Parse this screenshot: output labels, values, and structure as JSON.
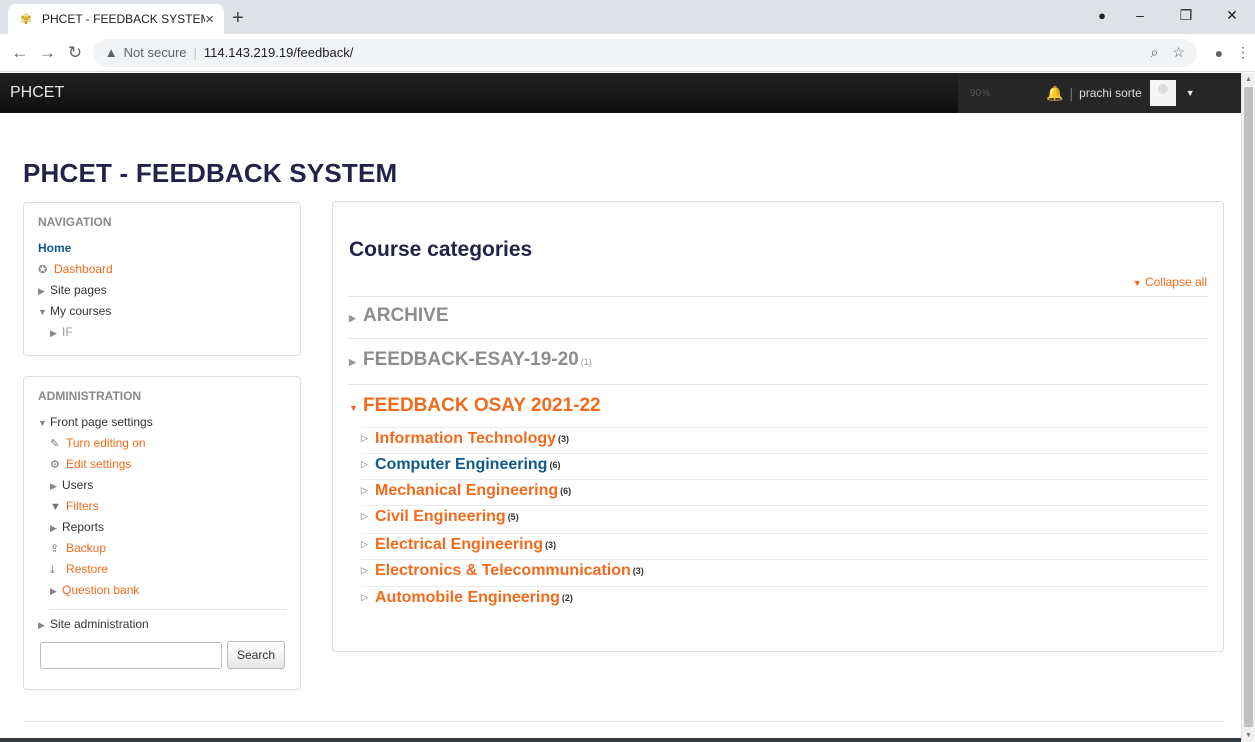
{
  "browser": {
    "tab_title": "PHCET - FEEDBACK SYSTEM",
    "tab_close": "×",
    "new_tab": "+",
    "security_label": "Not secure",
    "url": "114.143.219.19/feedback/",
    "icons": [
      "back-icon",
      "forward-icon",
      "reload-icon",
      "warning-icon",
      "zoom-icon",
      "star-icon",
      "profile-icon",
      "menu-icon"
    ]
  },
  "navbar": {
    "brand": "PHCET",
    "zoom_level": "90%",
    "user_name": "prachi sorte"
  },
  "site": {
    "title": "PHCET - FEEDBACK SYSTEM"
  },
  "navigation": {
    "title": "NAVIGATION",
    "home": "Home",
    "dashboard": "Dashboard",
    "site_pages": "Site pages",
    "my_courses": "My courses",
    "course_if": "IF"
  },
  "administration": {
    "title": "ADMINISTRATION",
    "front_page_settings": "Front page settings",
    "items": [
      {
        "label": "Turn editing on",
        "icon": "pencil-icon"
      },
      {
        "label": "Edit settings",
        "icon": "gear-icon"
      },
      {
        "label": "Users",
        "icon": "triangle-right-icon"
      },
      {
        "label": "Filters",
        "icon": "filter-icon"
      },
      {
        "label": "Reports",
        "icon": "triangle-right-icon"
      },
      {
        "label": "Backup",
        "icon": "upload-icon"
      },
      {
        "label": "Restore",
        "icon": "download-icon"
      },
      {
        "label": "Question bank",
        "icon": "triangle-right-icon"
      }
    ],
    "site_administration": "Site administration",
    "search_value": "",
    "search_button": "Search"
  },
  "main": {
    "heading": "Course categories",
    "collapse_all": "Collapse all",
    "categories": [
      {
        "name": "ARCHIVE",
        "count": ""
      },
      {
        "name": "FEEDBACK-ESAY-19-20",
        "count": "(1)"
      },
      {
        "name": "FEEDBACK OSAY 2021-22",
        "count": ""
      }
    ],
    "subcategories": [
      {
        "name": "Information Technology",
        "count": "(3)"
      },
      {
        "name": "Computer Engineering",
        "count": "(6)"
      },
      {
        "name": "Mechanical Engineering",
        "count": "(6)"
      },
      {
        "name": "Civil Engineering",
        "count": "(5)"
      },
      {
        "name": "Electrical Engineering",
        "count": "(3)"
      },
      {
        "name": "Electronics & Telecommunication",
        "count": "(3)"
      },
      {
        "name": "Automobile Engineering",
        "count": "(2)"
      }
    ]
  },
  "colors": {
    "link_orange": "#f26b1d",
    "link_blue": "#0f5a8c",
    "title_navy": "#23234a",
    "navbar_black": "#111111"
  }
}
